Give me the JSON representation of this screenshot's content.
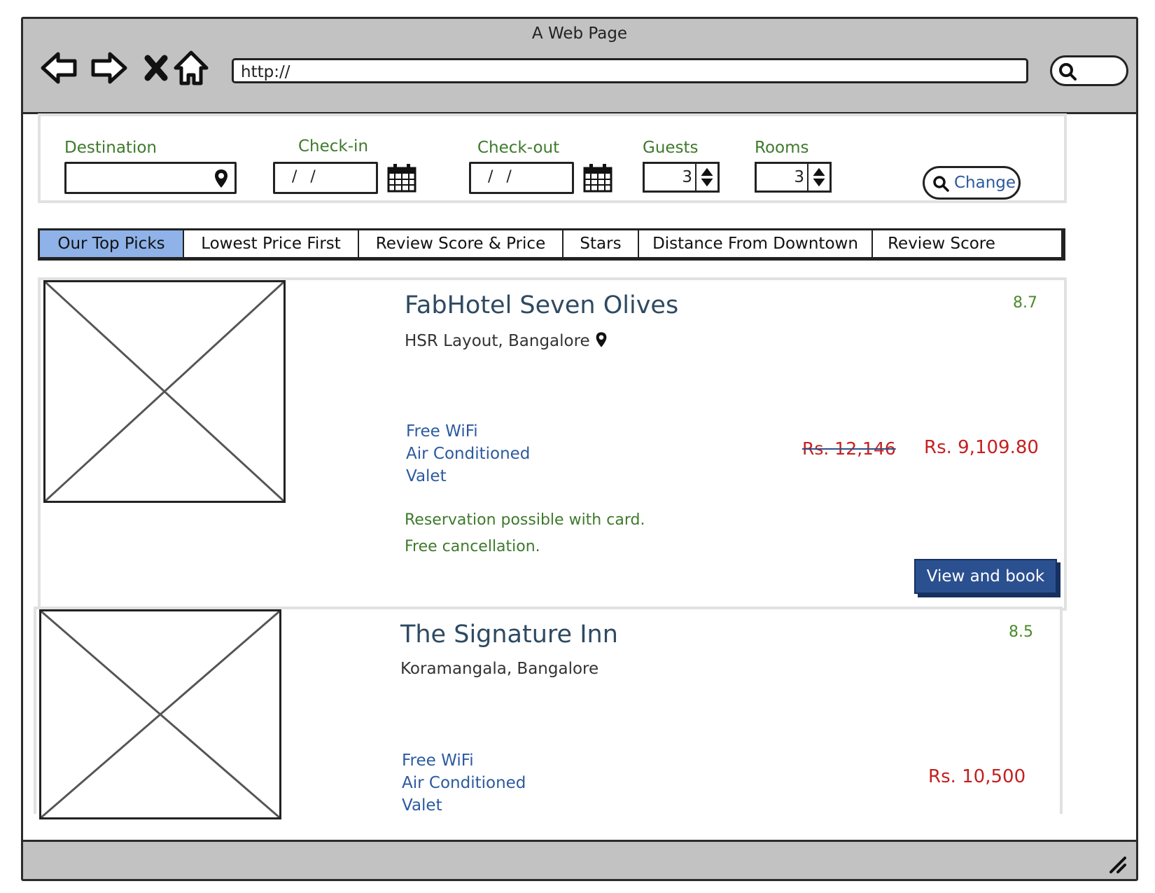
{
  "window": {
    "title": "A Web Page"
  },
  "browser": {
    "url": "http://",
    "icons": [
      "back-arrow-icon",
      "forward-arrow-icon",
      "close-x-icon",
      "home-icon",
      "search-icon"
    ]
  },
  "search": {
    "destination_label": "Destination",
    "checkin_label": "Check-in",
    "checkin_value": "/ /",
    "checkout_label": "Check-out",
    "checkout_value": "/ /",
    "guests_label": "Guests",
    "guests_value": "3",
    "rooms_label": "Rooms",
    "rooms_value": "3",
    "change_label": "Change"
  },
  "tabs": [
    {
      "label": "Our Top Picks",
      "active": true
    },
    {
      "label": "Lowest Price First"
    },
    {
      "label": "Review Score & Price"
    },
    {
      "label": "Stars"
    },
    {
      "label": "Distance From Downtown"
    },
    {
      "label": "Review Score"
    }
  ],
  "hotels": [
    {
      "name": "FabHotel Seven Olives",
      "location": "HSR Layout, Bangalore",
      "score": "8.7",
      "amenities": [
        "Free WiFi",
        "Air Conditioned",
        "Valet"
      ],
      "old_price": "Rs. 12,146",
      "price": "Rs. 9,109.80",
      "note1": "Reservation possible with card.",
      "note2": "Free cancellation.",
      "book_label": "View and book"
    },
    {
      "name": "The Signature Inn",
      "location": "Koramangala, Bangalore",
      "score": "8.5",
      "amenities": [
        "Free WiFi",
        "Air Conditioned",
        "Valet"
      ],
      "price": "Rs. 10,500"
    }
  ],
  "colors": {
    "label_green": "#3e7a2c",
    "amenity_blue": "#2c5aa0",
    "price_red": "#c52020",
    "active_tab": "#8fb2e8",
    "book_button": "#2b5090"
  }
}
